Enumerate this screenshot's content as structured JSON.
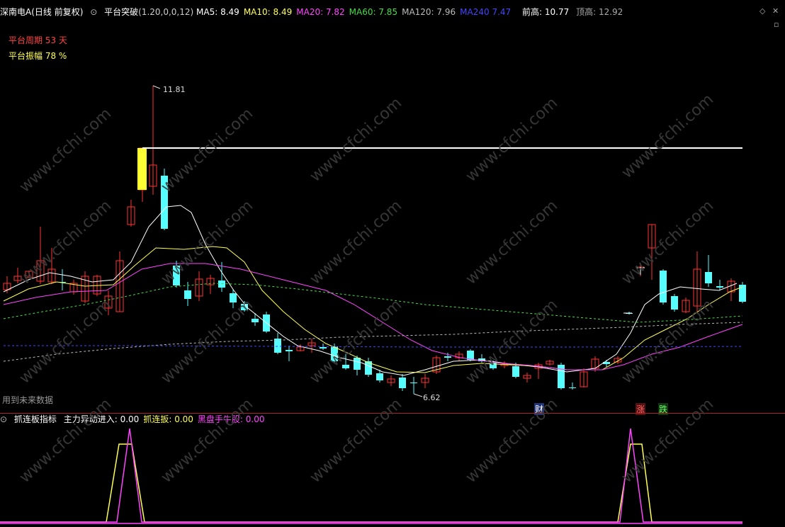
{
  "header": {
    "stock_name": "深南电A(日线 前复权)",
    "indicator_name": "平台突破",
    "indicator_params": "(1.20,0,0,12)",
    "ma": [
      {
        "label": "MA5:",
        "value": "8.49",
        "color": "#ffffff"
      },
      {
        "label": "MA10:",
        "value": "8.49",
        "color": "#ffff55"
      },
      {
        "label": "MA20:",
        "value": "7.82",
        "color": "#ff44ff"
      },
      {
        "label": "MA60:",
        "value": "7.85",
        "color": "#44dd44"
      },
      {
        "label": "MA120:",
        "value": "7.96",
        "color": "#bbbbbb"
      },
      {
        "label": "MA240",
        "value": "7.47",
        "color": "#4444ff"
      }
    ],
    "prev_high_label": "前高:",
    "prev_high_value": "10.77",
    "top_high_label": "顶高:",
    "top_high_value": "12.92"
  },
  "overlay": {
    "platform_period_label": "平台周期",
    "platform_period_value": "53 天",
    "platform_amplitude_label": "平台振幅",
    "platform_amplitude_value": "78 %",
    "high_marker": "11.81",
    "low_marker": "6.62",
    "future_data_note": "用到未来数据",
    "tags": [
      "财",
      "涨",
      "跌"
    ]
  },
  "sub_header": {
    "indicator_name": "抓连板指标",
    "items": [
      {
        "label": "主力异动进入:",
        "value": "0.00",
        "color": "#ffffff"
      },
      {
        "label": "抓连扳:",
        "value": "0.00",
        "color": "#ffff55"
      },
      {
        "label": "黑盘手牛股:",
        "value": "0.00",
        "color": "#ff44ff"
      }
    ]
  },
  "watermark_text": "www.cfchi.com",
  "colors": {
    "up": "#ff3333",
    "down": "#55ffff",
    "platform_line": "#ffffff",
    "limit_up": "#ffff33"
  }
}
